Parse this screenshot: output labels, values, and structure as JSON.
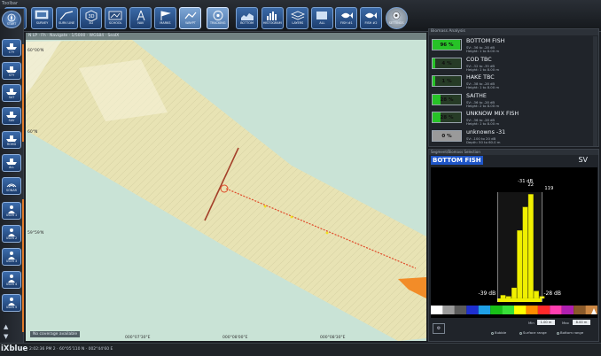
{
  "window_label": "Toolbar",
  "toolbar": {
    "buttons": [
      {
        "id": "nav",
        "label": "NAVIG",
        "icon": "monitor-icon",
        "active": false
      },
      {
        "id": "survey",
        "label": "SURVEY",
        "icon": "screen-icon",
        "active": false
      },
      {
        "id": "survey-2",
        "label": "SURV LINE",
        "icon": "line-icon",
        "active": false
      },
      {
        "id": "3d",
        "label": "3D",
        "icon": "cube-icon",
        "active": false
      },
      {
        "id": "school",
        "label": "SCHOOL",
        "icon": "map-icon",
        "active": false
      },
      {
        "id": "draw",
        "label": "NAV",
        "icon": "compass-icon",
        "active": false
      },
      {
        "id": "marks",
        "label": "MARKS",
        "icon": "flag-icon",
        "active": false
      },
      {
        "id": "waypoints",
        "label": "WAYPT",
        "icon": "route-icon",
        "active": true
      },
      {
        "id": "tracking",
        "label": "TRACKING",
        "icon": "target-icon",
        "active": true
      },
      {
        "id": "bottom",
        "label": "BOTTOM",
        "icon": "seabed-icon",
        "active": false
      },
      {
        "id": "echogram",
        "label": "HISTOGRAM",
        "icon": "histogram-icon",
        "active": false
      },
      {
        "id": "layers",
        "label": "LAYERS",
        "icon": "layers-icon",
        "active": false
      },
      {
        "id": "all",
        "label": "ALL",
        "icon": "all-icon",
        "active": false
      },
      {
        "id": "fish1",
        "label": "FISH #1",
        "icon": "fish-icon",
        "active": false
      },
      {
        "id": "fish2",
        "label": "FISH #2",
        "icon": "fish-icon",
        "active": false
      },
      {
        "id": "settings",
        "label": "SETTINGS",
        "icon": "gear-icon",
        "active": false
      }
    ]
  },
  "sidebar": {
    "start_label": "START",
    "items": [
      {
        "label": "CTY",
        "icon": "ship-icon"
      },
      {
        "label": "STY",
        "icon": "ship-icon"
      },
      {
        "label": "SAT",
        "icon": "ship-icon"
      },
      {
        "label": "SAV",
        "icon": "ship-icon"
      },
      {
        "label": "ROHD",
        "icon": "ship-icon"
      },
      {
        "label": "ALL",
        "icon": "ship-icon"
      },
      {
        "label": "SONAR",
        "icon": "sonar-icon"
      },
      {
        "label": "USER 1",
        "icon": "user-icon"
      },
      {
        "label": "USER 2",
        "icon": "user-icon"
      },
      {
        "label": "USER 3",
        "icon": "user-icon"
      },
      {
        "label": "USER 4",
        "icon": "user-icon"
      },
      {
        "label": "USER 5",
        "icon": "user-icon"
      }
    ]
  },
  "map": {
    "header": "N LP · Fh · Navigate · 1/5000 · WGS84 · SeaIX",
    "lat_labels": [
      "60°00'N",
      "60°N",
      "59°59'N"
    ],
    "lon_labels": [
      "000°07'30\"E",
      "000°08'00\"E",
      "000°08'30\"E"
    ],
    "coverage_note": "No coverage available",
    "colors": {
      "water": "#c9e3d6",
      "swath": "#e8e3b4",
      "track": "#e04a2a",
      "vessel": "#f28c28"
    }
  },
  "status": {
    "brand": "iXblue",
    "coords": "2:02:36 PM 2 · 60°05'110 N · 002°44'60 E"
  },
  "species": {
    "header": "Biomass Analysis",
    "items": [
      {
        "name": "BOTTOM FISH",
        "pct": 96,
        "pct_text": "96 %",
        "sv": "SV: -36 to -28 dB",
        "height": "Height: 1 to 8.00 m",
        "color": "#27c227"
      },
      {
        "name": "COD TBC",
        "pct": 4,
        "pct_text": "4 %",
        "sv": "SV: -32 to -35 dB",
        "height": "Height: 1 to 8.00 m",
        "color": "#27c227"
      },
      {
        "name": "HAKE TBC",
        "pct": 1,
        "pct_text": "1 %",
        "sv": "SV: -38 to -28 dB",
        "height": "Height: 1 to 8.00 m",
        "color": "#27c227"
      },
      {
        "name": "SAITHE",
        "pct": 28,
        "pct_text": "28 %",
        "sv": "SV: -36 to -28 dB",
        "height": "Height: 2 to 8.00 m",
        "color": "#27c227"
      },
      {
        "name": "UNKNOW MIX FISH",
        "pct": 28,
        "pct_text": "28 %",
        "sv": "SV: -36 to -28 dB",
        "height": "Height: 1 to 8.00 m",
        "color": "#27c227"
      },
      {
        "name": "unknowns -31",
        "pct": 0,
        "pct_text": "0 %",
        "sv": "SV: -100 to 20 dB",
        "height": "Depth: 50 to 60.0 m",
        "color": "#9a9a9a"
      }
    ]
  },
  "histogram": {
    "caption": "Segment/Biomass Selection",
    "title": "BOTTOM FISH",
    "mode": "SV",
    "footer": {
      "min_label": "Min",
      "min_value": "1.00 m",
      "max_label": "Max",
      "max_value": "8.00 m",
      "options": [
        "Bubble",
        "Surface range",
        "Bottom range"
      ]
    }
  },
  "chart_data": {
    "type": "bar",
    "xlabel": "",
    "ylabel": "",
    "title": "",
    "x_range": [
      -48,
      -18
    ],
    "x_unit": "dB",
    "y_range": [
      0,
      1.0
    ],
    "bins": [
      {
        "x": -35,
        "y": 0.03
      },
      {
        "x": -34,
        "y": 0.02
      },
      {
        "x": -33,
        "y": 0.1
      },
      {
        "x": -32,
        "y": 0.64
      },
      {
        "x": -31,
        "y": 0.86
      },
      {
        "x": -30,
        "y": 0.98
      },
      {
        "x": -29,
        "y": 0.07
      },
      {
        "x": -28,
        "y": 0.02
      }
    ],
    "annotations": [
      {
        "text": "-31 dB",
        "x": -31
      },
      {
        "text": "22",
        "x": -30
      },
      {
        "text": "119",
        "x": -28
      }
    ],
    "range_markers": [
      {
        "text": "-39 dB",
        "x": -36
      },
      {
        "text": "-28 dB",
        "x": -28
      }
    ],
    "palette": [
      "#ffffff",
      "#9a9a9a",
      "#5a5a5a",
      "#1e2fd0",
      "#1fa0e6",
      "#18c018",
      "#38e038",
      "#ffff00",
      "#ff8c00",
      "#ff2a2a",
      "#ff3fb0",
      "#b01fb0",
      "#8a5a2a",
      "#cc8844"
    ]
  }
}
